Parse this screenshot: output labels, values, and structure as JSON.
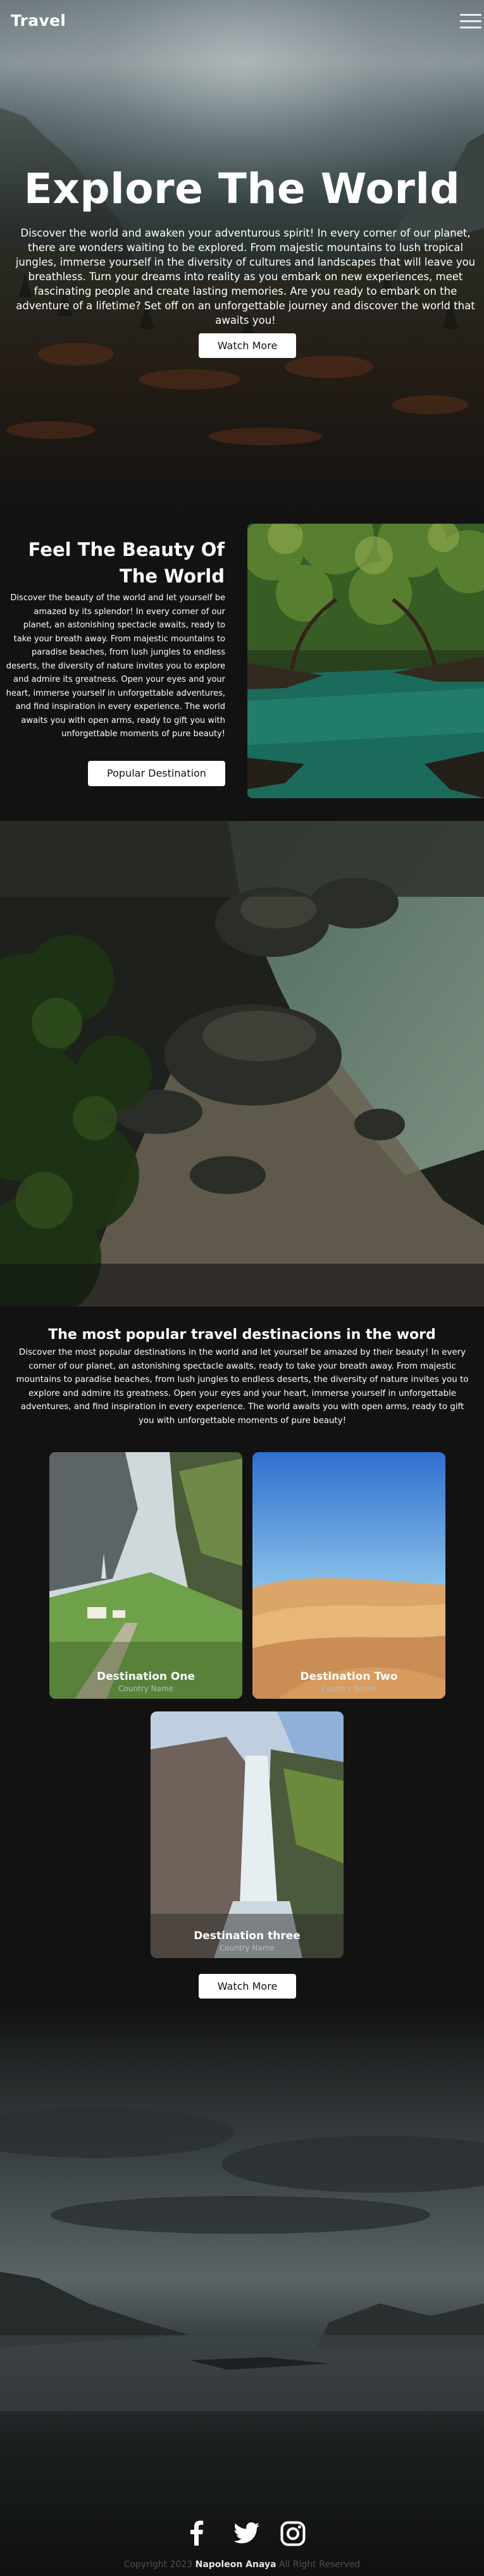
{
  "header": {
    "brand": "Travel",
    "menu_icon": "hamburger-menu-icon"
  },
  "hero": {
    "title": "Explore The World",
    "text": "Discover the world and awaken your adventurous spirit! In every corner of our planet, there are wonders waiting to be explored. From majestic mountains to lush tropical jungles, immerse yourself in the diversity of cultures and landscapes that will leave you breathless. Turn your dreams into reality as you embark on new experiences, meet fascinating people and create lasting memories. Are you ready to embark on the adventure of a lifetime? Set off on an unforgettable journey and discover the world that awaits you!",
    "button": "Watch More"
  },
  "beauty": {
    "title": "Feel The Beauty Of The World",
    "text": "Discover the beauty of the world and let yourself be amazed by its splendor! In every corner of our planet, an astonishing spectacle awaits, ready to take your breath away. From majestic mountains to paradise beaches, from lush jungles to endless deserts, the diversity of nature invites you to explore and admire its greatness. Open your eyes and your heart, immerse yourself in unforgettable adventures, and find inspiration in every experience. The world awaits you with open arms, ready to gift you with unforgettable moments of pure beauty!",
    "button": "Popular Destination"
  },
  "popular": {
    "title": "The most popular travel destinacions in the word",
    "text": "Discover the most popular destinations in the world and let yourself be amazed by their beauty! In every corner of our planet, an astonishing spectacle awaits, ready to take your breath away. From majestic mountains to paradise beaches, from lush jungles to endless deserts, the diversity of nature invites you to explore and admire its greatness. Open your eyes and your heart, immerse yourself in unforgettable adventures, and find inspiration in every experience. The world awaits you with open arms, ready to gift you with unforgettable moments of pure beauty!",
    "destinations": [
      {
        "name": "Destination One",
        "country": "Country Name"
      },
      {
        "name": "Destination Two",
        "country": "Country Name"
      },
      {
        "name": "Destination three",
        "country": "Country Name"
      }
    ],
    "button": "Watch More"
  },
  "footer": {
    "social_icons": [
      "facebook-icon",
      "twitter-icon",
      "instagram-icon"
    ],
    "copyright_prefix": "Copyright 2023",
    "author": "Napoleon Anaya",
    "rights": "All Right Reserved"
  }
}
